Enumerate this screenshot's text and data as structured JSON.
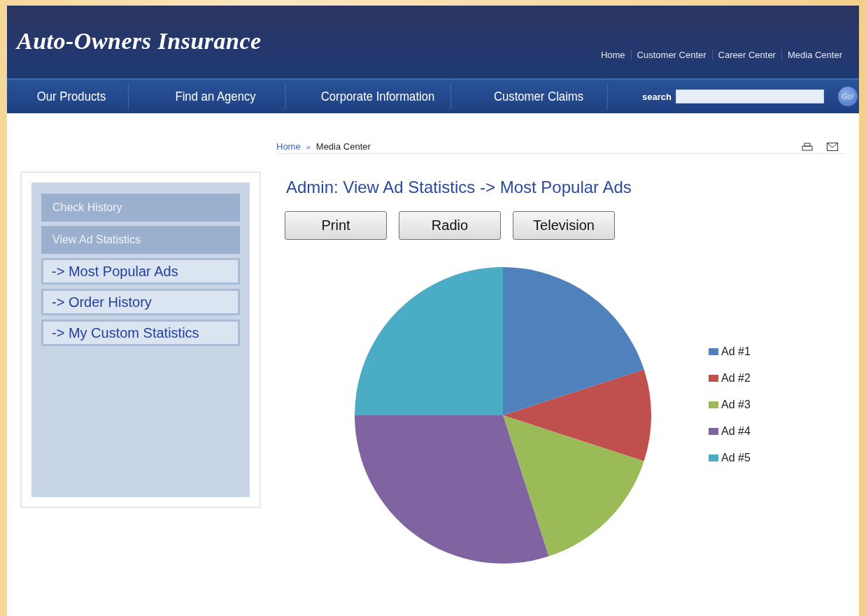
{
  "header": {
    "logo": "Auto-Owners Insurance",
    "top_links": [
      "Home",
      "Customer Center",
      "Career Center",
      "Media Center"
    ],
    "nav": [
      "Our Products",
      "Find an Agency",
      "Corporate Information",
      "Customer Claims"
    ],
    "search": {
      "label": "search",
      "button": "Go!"
    }
  },
  "breadcrumb_separator": "»",
  "breadcrumb": [
    {
      "label": "Home",
      "link": true
    },
    {
      "label": "Media Center",
      "link": false
    }
  ],
  "sidebar": {
    "items": [
      {
        "label": "Check History",
        "kind": "section"
      },
      {
        "label": "View Ad Statistics",
        "kind": "section"
      },
      {
        "label": "-> Most Popular Ads",
        "kind": "link"
      },
      {
        "label": "-> Order History",
        "kind": "link"
      },
      {
        "label": "-> My Custom Statistics",
        "kind": "link"
      }
    ]
  },
  "title": "Admin: View Ad Statistics -> Most Popular Ads",
  "buttons": [
    "Print",
    "Radio",
    "Television"
  ],
  "chart_data": {
    "type": "pie",
    "categories": [
      "Ad #1",
      "Ad #2",
      "Ad #3",
      "Ad #4",
      "Ad #5"
    ],
    "values": [
      20,
      10,
      15,
      30,
      25
    ],
    "colors": [
      "#4f81bd",
      "#c0504d",
      "#9bbb59",
      "#8064a2",
      "#4bacc6"
    ]
  }
}
